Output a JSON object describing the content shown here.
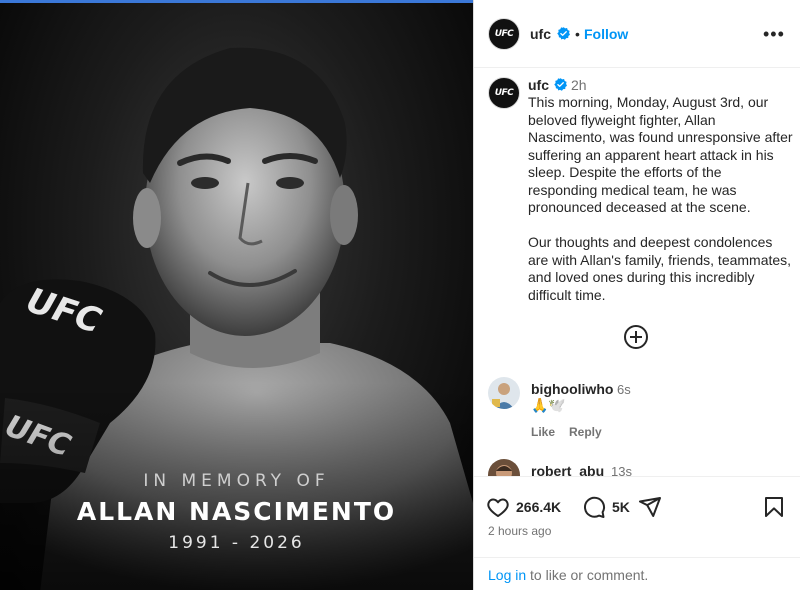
{
  "photo": {
    "memory_top": "IN MEMORY OF",
    "memory_name": "ALLAN NASCIMENTO",
    "memory_years": "1991 - 2026",
    "glove_text": "UFC"
  },
  "header": {
    "avatar_text": "UFC",
    "username": "ufc",
    "separator": "•",
    "follow_label": "Follow",
    "more_label": "•••"
  },
  "caption": {
    "avatar_text": "UFC",
    "username": "ufc",
    "time": "2h",
    "paragraph_1": "This morning, Monday, August 3rd, our beloved flyweight fighter, Allan Nascimento, was found unresponsive after suffering an apparent heart attack in his sleep. Despite the efforts of the responding medical team, he was pronounced deceased at the scene.",
    "paragraph_2": "Our thoughts and deepest condolences are with Allan's family, friends, teammates, and loved ones during this incredibly difficult time."
  },
  "comments": [
    {
      "username": "bighooliwho",
      "time": "6s",
      "text": "🙏🕊️",
      "like_label": "Like",
      "reply_label": "Reply"
    },
    {
      "username": "robert_abu",
      "time": "13s"
    }
  ],
  "footer": {
    "likes": "266.4K",
    "comments_count": "5K",
    "posted": "2 hours ago",
    "login_link": "Log in",
    "login_rest": " to like or comment."
  },
  "colors": {
    "accent": "#0095f6",
    "verified": "#0095f6",
    "muted": "#737373"
  },
  "icons": [
    "verified-icon",
    "more-options-icon",
    "add-comment-icon",
    "heart-icon",
    "comment-icon",
    "share-icon",
    "bookmark-icon"
  ]
}
